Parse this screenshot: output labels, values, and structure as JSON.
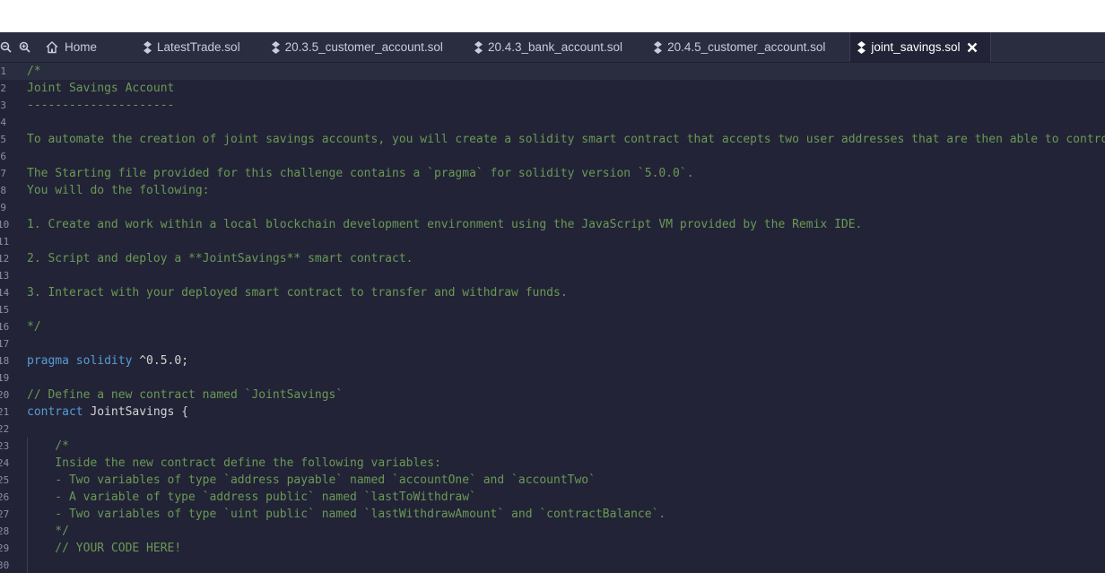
{
  "toolbar": {
    "zoom_out_icon": "zoom-out-icon",
    "zoom_in_icon": "zoom-in-icon"
  },
  "tabs": [
    {
      "label": "Home",
      "icon": "home-icon"
    },
    {
      "label": "LatestTrade.sol",
      "icon": "solidity-icon"
    },
    {
      "label": "20.3.5_customer_account.sol",
      "icon": "solidity-icon"
    },
    {
      "label": "20.4.3_bank_account.sol",
      "icon": "solidity-icon"
    },
    {
      "label": "20.4.5_customer_account.sol",
      "icon": "solidity-icon"
    },
    {
      "label": "joint_savings.sol",
      "icon": "solidity-icon",
      "active": true
    }
  ],
  "editor": {
    "lines": [
      {
        "n": "1",
        "text": "/*"
      },
      {
        "n": "2",
        "text": "Joint Savings Account"
      },
      {
        "n": "3",
        "text": "---------------------"
      },
      {
        "n": "4",
        "text": ""
      },
      {
        "n": "5",
        "text": "To automate the creation of joint savings accounts, you will create a solidity smart contract that accepts two user addresses that are then able to control"
      },
      {
        "n": "6",
        "text": ""
      },
      {
        "n": "7",
        "text": "The Starting file provided for this challenge contains a `pragma` for solidity version `5.0.0`."
      },
      {
        "n": "8",
        "text": "You will do the following:"
      },
      {
        "n": "9",
        "text": ""
      },
      {
        "n": "10",
        "text": "1. Create and work within a local blockchain development environment using the JavaScript VM provided by the Remix IDE."
      },
      {
        "n": "11",
        "text": ""
      },
      {
        "n": "12",
        "text": "2. Script and deploy a **JointSavings** smart contract."
      },
      {
        "n": "13",
        "text": ""
      },
      {
        "n": "14",
        "text": "3. Interact with your deployed smart contract to transfer and withdraw funds."
      },
      {
        "n": "15",
        "text": ""
      },
      {
        "n": "16",
        "text": "*/"
      },
      {
        "n": "17",
        "text": ""
      },
      {
        "n": "18",
        "kw": "pragma solidity",
        "rest": " ^0.5.0;"
      },
      {
        "n": "19",
        "text": ""
      },
      {
        "n": "20",
        "text": "// Define a new contract named `JointSavings`"
      },
      {
        "n": "21",
        "kw": "contract",
        "rest": " JointSavings {"
      },
      {
        "n": "22",
        "text": ""
      },
      {
        "n": "23",
        "text": "    /*"
      },
      {
        "n": "24",
        "text": "    Inside the new contract define the following variables:"
      },
      {
        "n": "25",
        "text": "    - Two variables of type `address payable` named `accountOne` and `accountTwo`"
      },
      {
        "n": "26",
        "text": "    - A variable of type `address public` named `lastToWithdraw`"
      },
      {
        "n": "27",
        "text": "    - Two variables of type `uint public` named `lastWithdrawAmount` and `contractBalance`."
      },
      {
        "n": "28",
        "text": "    */"
      },
      {
        "n": "29",
        "text": "    // YOUR CODE HERE!"
      },
      {
        "n": "30",
        "text": ""
      }
    ]
  },
  "colors": {
    "tabbar_bg": "#2a2c3f",
    "editor_bg": "#222336",
    "comment": "#6a9955",
    "keyword": "#569cd6",
    "plain": "#d4d4d4"
  }
}
